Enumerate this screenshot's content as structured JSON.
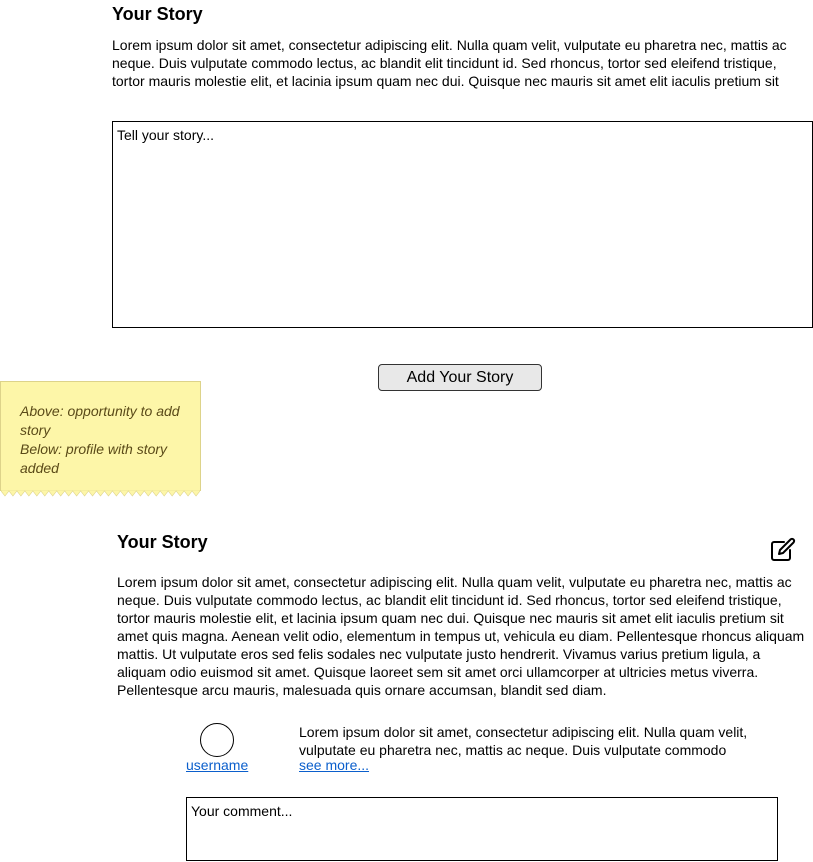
{
  "add_story_section": {
    "title": "Your Story",
    "intro": "Lorem ipsum dolor sit amet, consectetur adipiscing elit. Nulla quam velit, vulputate eu pharetra nec, mattis ac neque. Duis vulputate commodo lectus, ac blandit elit tincidunt id. Sed rhoncus, tortor sed eleifend tristique, tortor mauris molestie elit, et lacinia ipsum quam nec dui. Quisque nec mauris sit amet elit iaculis pretium sit",
    "textarea_placeholder": "Tell your story...",
    "submit_label": "Add Your Story"
  },
  "sticky_note": {
    "line1": "Above: opportunity to add story",
    "line2": "Below: profile with story added"
  },
  "profile_story_section": {
    "title": "Your Story",
    "edit_icon": "edit-pencil-square-icon",
    "body": "Lorem ipsum dolor sit amet, consectetur adipiscing elit. Nulla quam velit, vulputate eu pharetra nec, mattis ac neque. Duis vulputate commodo lectus, ac blandit elit tincidunt id. Sed rhoncus, tortor sed eleifend tristique, tortor mauris molestie elit, et lacinia ipsum quam nec dui. Quisque nec mauris sit amet elit iaculis pretium sit amet quis magna. Aenean velit odio, elementum in tempus ut, vehicula eu diam. Pellentesque rhoncus aliquam mattis. Ut vulputate eros sed felis sodales nec vulputate justo hendrerit. Vivamus varius pretium ligula, a aliquam odio euismod sit amet. Quisque laoreet sem sit amet orci ullamcorper at ultricies metus viverra. Pellentesque arcu mauris, malesuada quis ornare accumsan, blandit sed diam.",
    "comment": {
      "username": "username",
      "text": "Lorem ipsum dolor sit amet, consectetur adipiscing elit. Nulla quam velit, vulputate eu pharetra nec, mattis ac neque. Duis vulputate commodo",
      "see_more": "see more..."
    },
    "comment_placeholder": "Your comment..."
  },
  "colors": {
    "link": "#0b5fcc",
    "sticky_note": "#fdf6a8",
    "button_bg": "#e8e8e8"
  }
}
